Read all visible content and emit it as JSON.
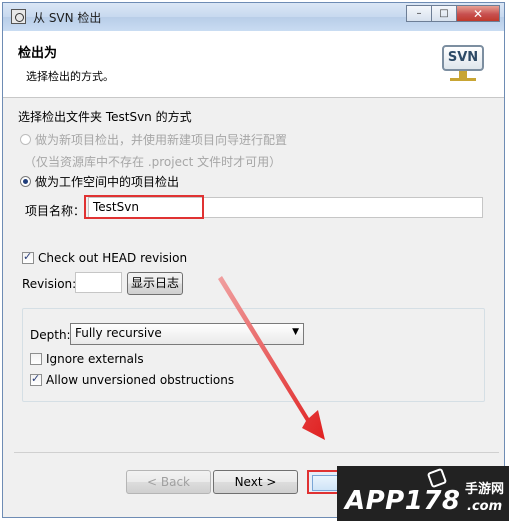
{
  "window": {
    "title": "从 SVN 检出",
    "minimize": "–",
    "maximize": "□",
    "close": "✕"
  },
  "header": {
    "title": "检出为",
    "description": "选择检出的方式。",
    "logo": "SVN"
  },
  "section": {
    "title": "选择检出文件夹 TestSvn 的方式",
    "option_new_project": "做为新项目检出，并使用新建项目向导进行配置",
    "option_note": "（仅当资源库中不存在 .project 文件时才可用）",
    "option_workspace": "做为工作空间中的项目检出"
  },
  "project_name": {
    "label": "项目名称：",
    "value": "TestSvn"
  },
  "head_revision": {
    "label": "Check out HEAD revision",
    "checked": true
  },
  "revision": {
    "label": "Revision:",
    "value": "",
    "show_log": "显示日志"
  },
  "depth": {
    "label": "Depth:",
    "selected": "Fully recursive"
  },
  "ignore_externals": {
    "label": "Ignore externals",
    "checked": false
  },
  "allow_unversioned": {
    "label": "Allow unversioned obstructions",
    "checked": true
  },
  "buttons": {
    "back": "< Back",
    "next": "Next >"
  },
  "watermark": {
    "brand": "APP178",
    "cn": "手游网",
    "domain": ".com"
  },
  "colors": {
    "highlight": "#e03232",
    "titlebar": "#c7d9ef"
  }
}
